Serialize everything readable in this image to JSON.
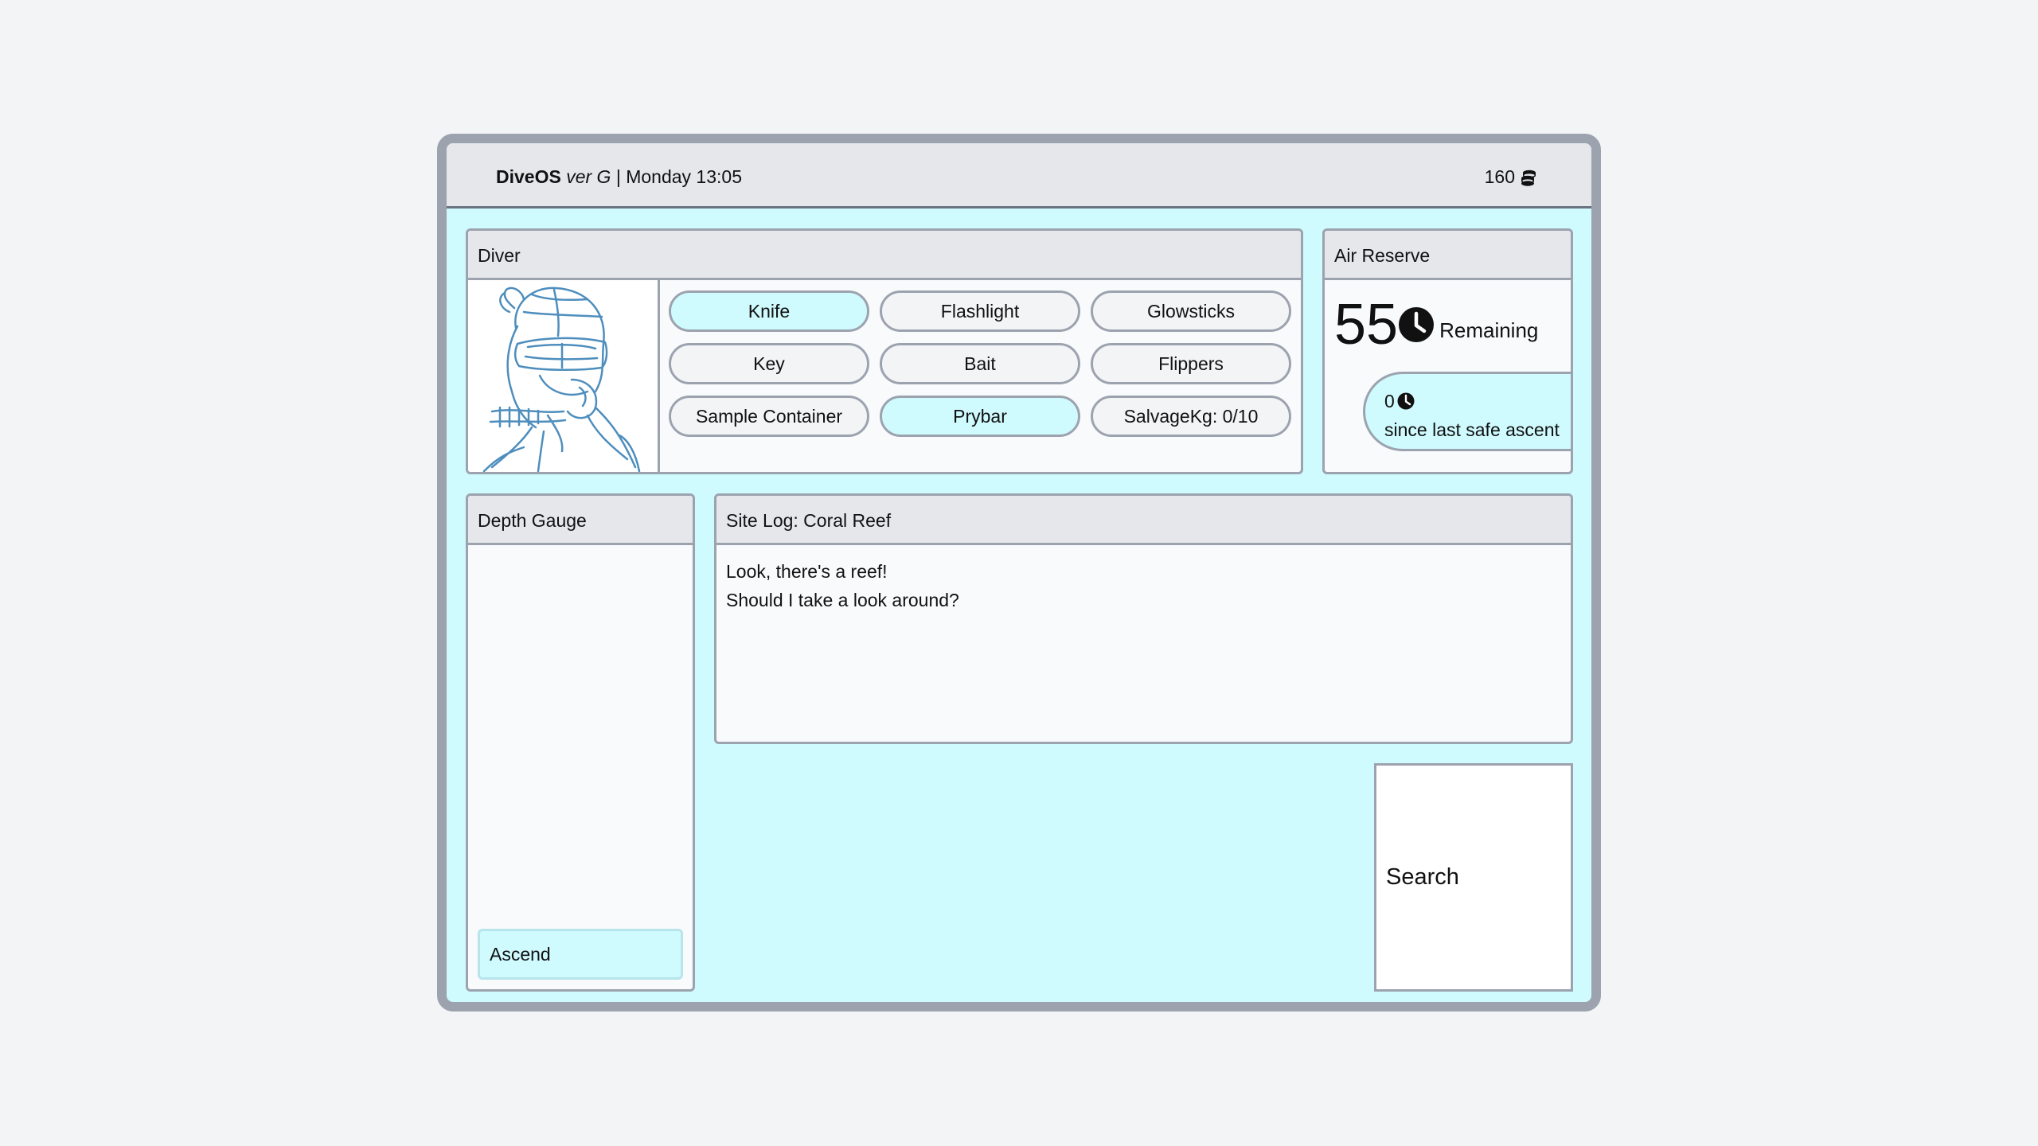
{
  "topbar": {
    "os_name": "DiveOS",
    "version": "ver G",
    "datetime": "| Monday 13:05",
    "coins": "160",
    "coins_icon": "coins-stack-icon"
  },
  "diver": {
    "title": "Diver",
    "portrait_icon": "diver-sketch-icon",
    "items": [
      {
        "label": "Knife",
        "active": true
      },
      {
        "label": "Flashlight",
        "active": false
      },
      {
        "label": "Glowsticks",
        "active": false
      },
      {
        "label": "Key",
        "active": false
      },
      {
        "label": "Bait",
        "active": false
      },
      {
        "label": "Flippers",
        "active": false
      },
      {
        "label": "Sample Container",
        "active": false
      },
      {
        "label": "Prybar",
        "active": true
      },
      {
        "label": "SalvageKg: 0/10",
        "active": false
      }
    ]
  },
  "air": {
    "title": "Air Reserve",
    "remaining_value": "55",
    "remaining_label": "Remaining",
    "clock_icon": "clock-icon",
    "since_value": "0",
    "since_label": "since last safe ascent"
  },
  "depth": {
    "title": "Depth Gauge",
    "ascend_label": "Ascend"
  },
  "sitelog": {
    "title": "Site Log: Coral Reef",
    "lines": [
      "Look, there's a reef!",
      "Should I take a look around?"
    ]
  },
  "search": {
    "label": "Search"
  },
  "colors": {
    "page_bg": "#f3f4f6",
    "device_bg": "#cffafe",
    "frame": "#9ca3af",
    "header_bg": "#e5e7eb",
    "active_pill": "#cffafe",
    "sketch_blue": "#3b82b6"
  }
}
